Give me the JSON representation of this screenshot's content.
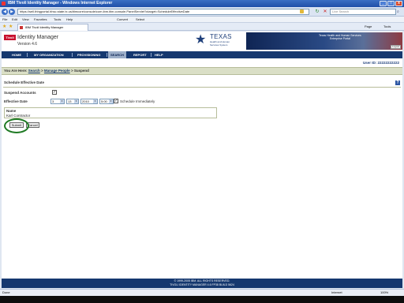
{
  "window": {
    "title": "IBM Tivoli Identity Manager - Windows Internet Explorer",
    "min": "_",
    "max": "□",
    "close": "x"
  },
  "browser": {
    "back": "◀",
    "forward": "▶",
    "url": "https://sell.thhgportal.hhsc.state.tx.us/itimcore/console/com.ibm.itim.console.PanelServlet?ctarget=ScheduleEffectiveDate",
    "refresh": "↻",
    "stop": "✕",
    "search_placeholder": "Live Search",
    "search_go": "⌕",
    "menu": [
      "File",
      "Edit",
      "View",
      "Favorites",
      "Tools",
      "Help"
    ],
    "toolbar": [
      "Convert",
      "Select"
    ],
    "tab_label": "IBM Tivoli Identity Manager",
    "ie_tools": [
      "Page",
      "Tools"
    ]
  },
  "app": {
    "logo": "Tivoli",
    "name": "Identity Manager",
    "version": "Version 4.6",
    "tx_title": "TEXAS",
    "tx_sub": "Health and Human\nServices System",
    "banner_text": "Texas Health and Human Services\nEnterprise Portal",
    "logout": "Logout"
  },
  "nav": [
    "HOME",
    "MY ORGANIZATION",
    "PROVISIONING",
    "SEARCH",
    "REPORT",
    "HELP"
  ],
  "nav_active": "SEARCH",
  "user_id": "User ID: 22222222222",
  "breadcrumb": {
    "prefix": "You Are Here: ",
    "links": [
      "Search",
      "Manage People"
    ],
    "sep": " > ",
    "current": "Suspend"
  },
  "form": {
    "section_title": "Schedule Effective Date",
    "help": "?",
    "suspend_label": "Suspend Accounts",
    "suspend_checked": "✓",
    "effective_label": "Effective Date",
    "month": "3",
    "day": "13",
    "year": "2010",
    "time": "5:00",
    "dropdown_arrow": "▾",
    "schedule_checked": "✓",
    "schedule_label": "Schedule Immediately",
    "name_label": "Name",
    "name_value": "Karl Contractor",
    "submit": "Submit",
    "cancel": "Cancel"
  },
  "footer": {
    "line1": "© 1999-2005 IBM. ALL RIGHTS RESERVED.",
    "line2": "TIVOLI IDENTITY MANAGER 4.6 FP38 BUILD 5624"
  },
  "status": {
    "text": "Done",
    "zone": "Internet",
    "zoom": "100%"
  }
}
